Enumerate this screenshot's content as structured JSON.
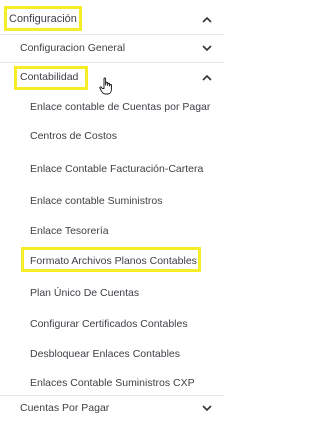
{
  "menu": {
    "configuracion": {
      "label": "Configuración",
      "chevron_icon": "chevron-up-icon"
    },
    "configuracion_general": {
      "label": "Configuracion General",
      "chevron_icon": "chevron-down-icon"
    },
    "contabilidad": {
      "label": "Contabilidad",
      "chevron_icon": "chevron-up-icon",
      "items": [
        {
          "label": "Enlace contable de Cuentas por Pagar"
        },
        {
          "label": "Centros de Costos"
        },
        {
          "label": "Enlace Contable Facturación-Cartera"
        },
        {
          "label": "Enlace contable Suministros"
        },
        {
          "label": "Enlace Tesorería"
        },
        {
          "label": "Formato Archivos Planos Contables"
        },
        {
          "label": "Plan Único De Cuentas"
        },
        {
          "label": "Configurar Certificados Contables"
        },
        {
          "label": "Desbloquear Enlaces Contables"
        },
        {
          "label": "Enlaces Contable Suministros CXP"
        }
      ]
    },
    "cuentas_por_pagar": {
      "label": "Cuentas Por Pagar",
      "chevron_icon": "chevron-down-icon"
    }
  },
  "colors": {
    "highlight": "#f5ed25",
    "text": "#3f3f46",
    "divider": "#e6e6e6"
  }
}
